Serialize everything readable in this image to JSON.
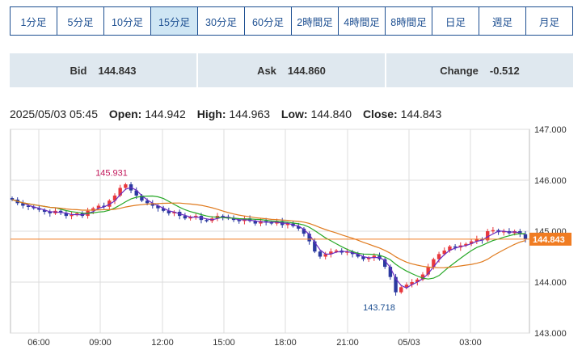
{
  "timeframes": [
    {
      "label": "1分足",
      "active": false
    },
    {
      "label": "5分足",
      "active": false
    },
    {
      "label": "10分足",
      "active": false
    },
    {
      "label": "15分足",
      "active": true
    },
    {
      "label": "30分足",
      "active": false
    },
    {
      "label": "60分足",
      "active": false
    },
    {
      "label": "2時間足",
      "active": false
    },
    {
      "label": "4時間足",
      "active": false
    },
    {
      "label": "8時間足",
      "active": false
    },
    {
      "label": "日足",
      "active": false
    },
    {
      "label": "週足",
      "active": false
    },
    {
      "label": "月足",
      "active": false
    }
  ],
  "quotes": {
    "bid_label": "Bid",
    "bid_value": "144.843",
    "ask_label": "Ask",
    "ask_value": "144.860",
    "change_label": "Change",
    "change_value": "-0.512"
  },
  "ohlc": {
    "datetime": "2025/05/03 05:45",
    "open_label": "Open:",
    "open": "144.942",
    "high_label": "High:",
    "high": "144.963",
    "low_label": "Low:",
    "low": "144.840",
    "close_label": "Close:",
    "close": "144.843"
  },
  "colors": {
    "up": "#e8383d",
    "down": "#2b3aa0",
    "ma_short": "#6a2bc2",
    "ma_mid": "#27a827",
    "ma_long": "#e07b1f",
    "price_line": "#f07c22",
    "tab_border": "#1d4f91",
    "tab_active_bg": "#cfe6f4",
    "quote_bg": "#dfe8ef"
  },
  "chart_data": {
    "type": "candlestick",
    "x_ticks": [
      "06:00",
      "09:00",
      "12:00",
      "15:00",
      "18:00",
      "21:00",
      "05/03",
      "03:00"
    ],
    "y_ticks": [
      "147.000",
      "146.000",
      "145.000",
      "144.000",
      "143.000"
    ],
    "ylim": [
      143.0,
      147.0
    ],
    "current_price_label": "144.843",
    "current_price": 144.843,
    "annotations": [
      {
        "text": "145.931",
        "value": 145.931,
        "kind": "high"
      },
      {
        "text": "143.718",
        "value": 143.718,
        "kind": "low"
      }
    ],
    "grid": true,
    "closes": [
      145.62,
      145.55,
      145.5,
      145.48,
      145.45,
      145.42,
      145.38,
      145.35,
      145.4,
      145.36,
      145.3,
      145.32,
      145.35,
      145.3,
      145.4,
      145.45,
      145.5,
      145.48,
      145.6,
      145.7,
      145.85,
      145.92,
      145.8,
      145.7,
      145.6,
      145.55,
      145.5,
      145.45,
      145.4,
      145.35,
      145.38,
      145.3,
      145.25,
      145.28,
      145.3,
      145.22,
      145.2,
      145.25,
      145.3,
      145.28,
      145.25,
      145.22,
      145.2,
      145.25,
      145.2,
      145.15,
      145.2,
      145.18,
      145.15,
      145.2,
      145.12,
      145.15,
      145.1,
      145.05,
      144.95,
      144.8,
      144.6,
      144.5,
      144.55,
      144.6,
      144.62,
      144.58,
      144.6,
      144.55,
      144.5,
      144.45,
      144.48,
      144.52,
      144.45,
      144.3,
      144.1,
      143.8,
      143.9,
      143.95,
      144.0,
      144.05,
      144.15,
      144.3,
      144.45,
      144.55,
      144.62,
      144.7,
      144.68,
      144.72,
      144.75,
      144.8,
      144.85,
      144.82,
      145.0,
      145.02,
      144.98,
      145.0,
      144.96,
      145.0,
      144.94,
      144.843
    ]
  }
}
